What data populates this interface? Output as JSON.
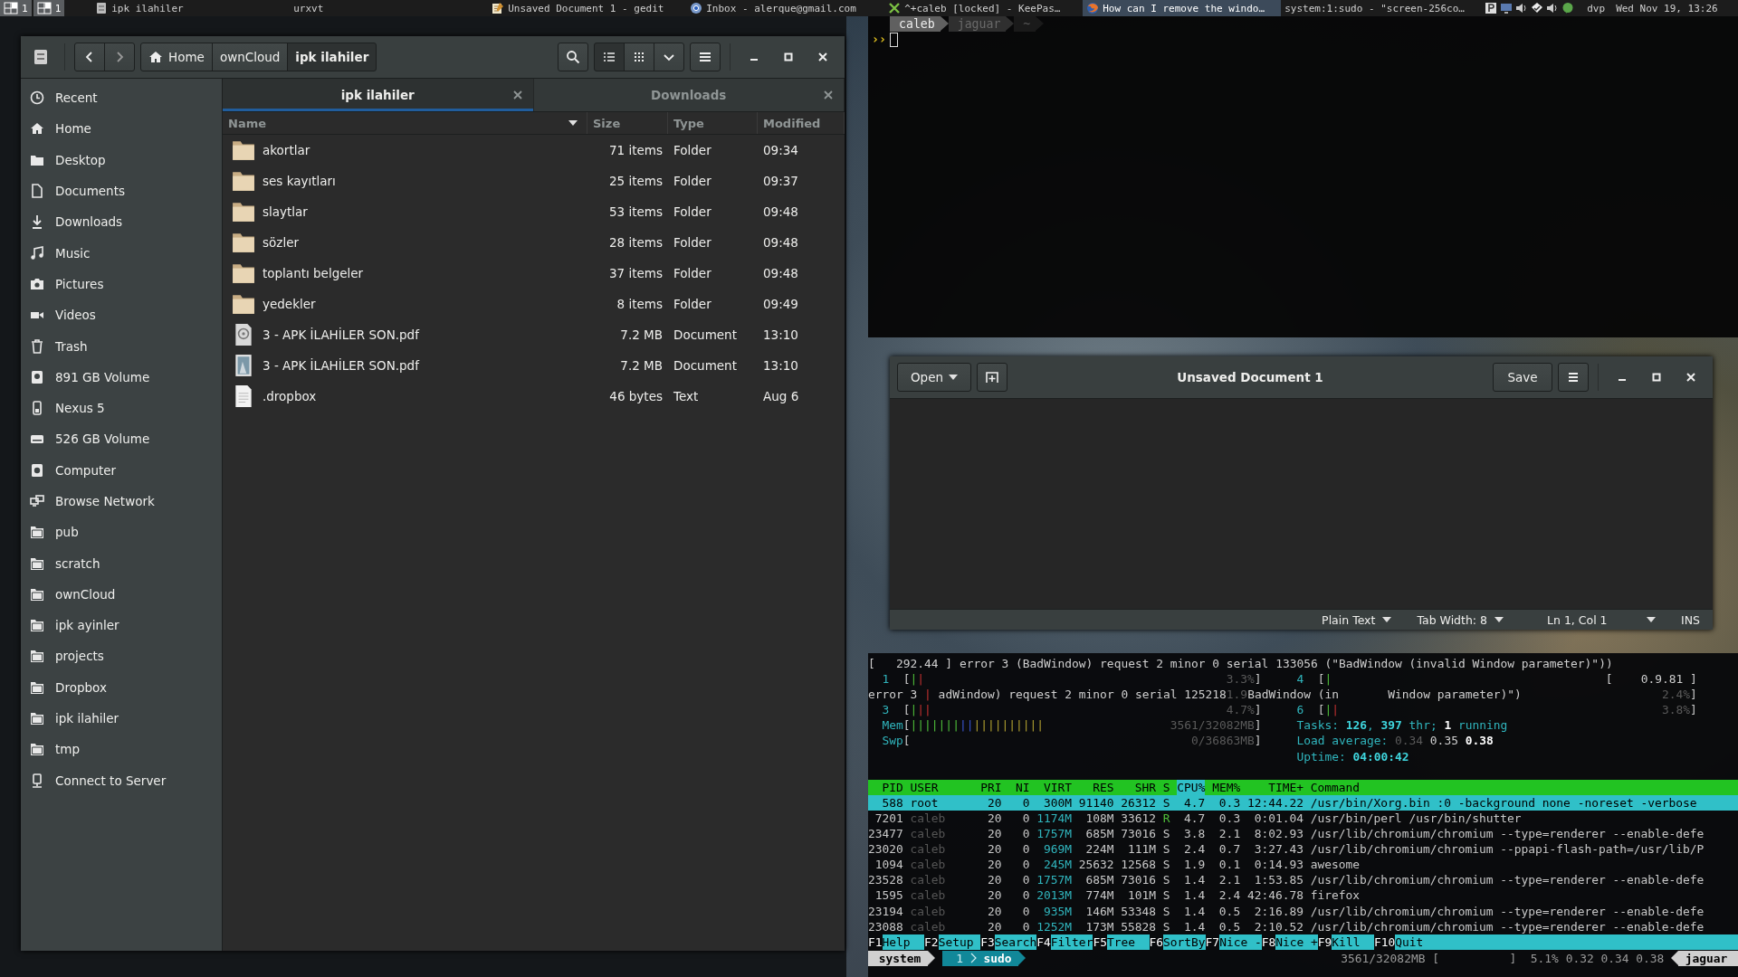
{
  "taskbar": {
    "workspaces": [
      {
        "label": "1"
      },
      {
        "label": "1"
      }
    ],
    "tasks": [
      {
        "title": "ipk ilahiler",
        "kind": "files",
        "selected": false
      },
      {
        "title": "urxvt",
        "kind": "plain",
        "selected": false
      },
      {
        "title": "Unsaved Document 1 - gedit",
        "kind": "editor",
        "selected": false
      },
      {
        "title": "Inbox - alerque@gmail.com",
        "kind": "chrome",
        "selected": false
      },
      {
        "title": "^+caleb [locked] - KeePas…",
        "kind": "keepass",
        "selected": false
      },
      {
        "title": "How can I remove the windo…",
        "kind": "firefox",
        "selected": true
      },
      {
        "title": "system:1:sudo - \"screen-256co…",
        "kind": "plain",
        "selected": false
      }
    ],
    "user": "dvp",
    "clock": "Wed Nov 19, 13:26"
  },
  "terminal": {
    "prompt": [
      {
        "text": "caleb"
      },
      {
        "text": "jaguar"
      },
      {
        "text": "~"
      }
    ],
    "input_prompt": "››"
  },
  "file_manager": {
    "breadcrumbs": [
      {
        "label": "Home",
        "selected": false
      },
      {
        "label": "ownCloud",
        "selected": false
      },
      {
        "label": "ipk ilahiler",
        "selected": true
      }
    ],
    "sidebar": [
      {
        "label": "Recent",
        "kind": "recent"
      },
      {
        "label": "Home",
        "kind": "home"
      },
      {
        "label": "Desktop",
        "kind": "desktop"
      },
      {
        "label": "Documents",
        "kind": "documents"
      },
      {
        "label": "Downloads",
        "kind": "downloads"
      },
      {
        "label": "Music",
        "kind": "music"
      },
      {
        "label": "Pictures",
        "kind": "pictures"
      },
      {
        "label": "Videos",
        "kind": "videos"
      },
      {
        "label": "Trash",
        "kind": "trash"
      },
      {
        "label": "891 GB Volume",
        "kind": "volume"
      },
      {
        "label": "Nexus 5",
        "kind": "phone"
      },
      {
        "label": "526 GB Volume",
        "kind": "drive"
      },
      {
        "label": "Computer",
        "kind": "computer"
      },
      {
        "label": "Browse Network",
        "kind": "network"
      },
      {
        "label": "pub",
        "kind": "folder"
      },
      {
        "label": "scratch",
        "kind": "folder"
      },
      {
        "label": "ownCloud",
        "kind": "folder"
      },
      {
        "label": "ipk ayinler",
        "kind": "folder"
      },
      {
        "label": "projects",
        "kind": "folder"
      },
      {
        "label": "Dropbox",
        "kind": "folder"
      },
      {
        "label": "ipk ilahiler",
        "kind": "folder"
      },
      {
        "label": "tmp",
        "kind": "folder"
      },
      {
        "label": "Connect to Server",
        "kind": "server"
      }
    ],
    "tabs": [
      {
        "label": "ipk ilahiler",
        "selected": true
      },
      {
        "label": "Downloads",
        "selected": false
      }
    ],
    "columns": [
      {
        "label": "Name",
        "sorted": true
      },
      {
        "label": "Size",
        "sorted": false
      },
      {
        "label": "Type",
        "sorted": false
      },
      {
        "label": "Modified",
        "sorted": false
      }
    ],
    "files": [
      {
        "name": "akortlar",
        "size": "71 items",
        "type": "Folder",
        "modified": "09:34",
        "kind": "folder"
      },
      {
        "name": "ses kayıtları",
        "size": "25 items",
        "type": "Folder",
        "modified": "09:37",
        "kind": "folder"
      },
      {
        "name": "slaytlar",
        "size": "53 items",
        "type": "Folder",
        "modified": "09:48",
        "kind": "folder"
      },
      {
        "name": "sözler",
        "size": "28 items",
        "type": "Folder",
        "modified": "09:48",
        "kind": "folder"
      },
      {
        "name": "toplantı belgeler",
        "size": "37 items",
        "type": "Folder",
        "modified": "09:48",
        "kind": "folder"
      },
      {
        "name": "yedekler",
        "size": "8 items",
        "type": "Folder",
        "modified": "09:49",
        "kind": "folder"
      },
      {
        "name": "3 - APK İLAHİLER SON.pdf",
        "size": "7.2 MB",
        "type": "Document",
        "modified": "13:10",
        "kind": "document"
      },
      {
        "name": "3 - APK İLAHİLER SON.pdf",
        "size": "7.2 MB",
        "type": "Document",
        "modified": "13:10",
        "kind": "document-image"
      },
      {
        "name": ".dropbox",
        "size": "46 bytes",
        "type": "Text",
        "modified": "Aug 6",
        "kind": "text"
      }
    ]
  },
  "editor": {
    "open": "Open",
    "title": "Unsaved Document 1",
    "save": "Save",
    "status": [
      {
        "label": "Plain Text",
        "dropdown": true
      },
      {
        "label": "Tab Width: 8",
        "dropdown": true
      },
      {
        "label": "Ln 1, Col 1",
        "dropdown": true
      },
      {
        "label": "INS",
        "dropdown": false
      }
    ]
  },
  "htop": {
    "top": [
      {
        "kind": "message",
        "segments": [
          {
            "text": "[   292.44 ] error 3 (BadWindow) request 2 minor 0 serial 133056 (\"BadWindow (invalid Window parameter)\"))",
            "kind": "text"
          }
        ]
      },
      {
        "kind": "meters",
        "left": {
          "label": "1",
          "open": "[",
          "bars": [
            {
              "text": "|",
              "kind": "green"
            },
            {
              "text": "|",
              "kind": "red"
            }
          ],
          "reading": {
            "text": "3.3%",
            "kind": "dim"
          },
          "close": "]"
        },
        "right": {
          "label": "4",
          "open": "[",
          "bars": [
            {
              "text": "|",
              "kind": "green"
            }
          ],
          "reading": {
            "text": "[    0.9.81 ]",
            "kind": "text"
          }
        }
      },
      {
        "kind": "message",
        "segments": [
          {
            "text": "error 3 ",
            "kind": "text"
          },
          {
            "text": "|",
            "kind": "red"
          },
          {
            "text": " adWindow) request 2 minor 0 serial 125218",
            "kind": "text"
          },
          {
            "text": "1.9",
            "kind": "dim"
          },
          {
            "text": "BadWindow (in       Window parameter)\")",
            "kind": "text"
          }
        ],
        "reading": {
          "text": "2.4%",
          "kind": "dim"
        },
        "close": "]"
      },
      {
        "kind": "meters",
        "left": {
          "label": "3",
          "open": "[",
          "bars": [
            {
              "text": "|",
              "kind": "green"
            },
            {
              "text": "||",
              "kind": "red"
            }
          ],
          "reading": {
            "text": "4.7%",
            "kind": "dim"
          },
          "close": "]"
        },
        "right": {
          "label": "6",
          "open": "[",
          "bars": [
            {
              "text": "|",
              "kind": "green"
            },
            {
              "text": "|",
              "kind": "red"
            }
          ],
          "reading": {
            "text": "3.8%",
            "kind": "dim"
          },
          "close": "]"
        }
      },
      {
        "kind": "meters",
        "left": {
          "label": "Mem",
          "open": "[",
          "bars": [
            {
              "text": "|||||||",
              "kind": "green"
            },
            {
              "text": "||",
              "kind": "blue"
            },
            {
              "text": "||||||||||",
              "kind": "yellow"
            }
          ],
          "reading": {
            "text": "3561/32082MB",
            "kind": "dim"
          },
          "close": "]"
        },
        "info": [
          {
            "text": "Tasks: ",
            "kind": "cyan"
          },
          {
            "text": "126",
            "kind": "cyanbold"
          },
          {
            "text": ", ",
            "kind": "cyan"
          },
          {
            "text": "397",
            "kind": "cyanbold"
          },
          {
            "text": " thr; ",
            "kind": "cyan"
          },
          {
            "text": "1",
            "kind": "bold"
          },
          {
            "text": " running",
            "kind": "cyan"
          }
        ]
      },
      {
        "kind": "meters",
        "left": {
          "label": "Swp",
          "open": "[",
          "reading": {
            "text": "0/36863MB",
            "kind": "dim"
          },
          "close": "]"
        },
        "info": [
          {
            "text": "Load average: ",
            "kind": "cyan"
          },
          {
            "text": "0.34",
            "kind": "dim"
          },
          {
            "text": " 0.35 ",
            "kind": "text"
          },
          {
            "text": "0.38",
            "kind": "bold"
          }
        ]
      },
      {
        "kind": "meters",
        "info": [
          {
            "text": "Uptime: ",
            "kind": "cyan"
          },
          {
            "text": "04:00:42",
            "kind": "cyanbold"
          }
        ]
      }
    ],
    "columns": [
      {
        "label": "PID",
        "sorted": false
      },
      {
        "label": "USER",
        "sorted": false
      },
      {
        "label": "PRI",
        "sorted": false
      },
      {
        "label": "NI",
        "sorted": false
      },
      {
        "label": "VIRT",
        "sorted": false
      },
      {
        "label": "RES",
        "sorted": false
      },
      {
        "label": "SHR",
        "sorted": false
      },
      {
        "label": "S",
        "sorted": false
      },
      {
        "label": "CPU%",
        "sorted": true
      },
      {
        "label": "MEM%",
        "sorted": false
      },
      {
        "label": "TIME+",
        "sorted": false
      },
      {
        "label": "Command",
        "sorted": false
      }
    ],
    "processes": [
      {
        "pid": "588",
        "user": "root",
        "pri": "20",
        "ni": "0",
        "virt": "300M",
        "res": "91140",
        "shr": "26312",
        "state": "S",
        "cpu": "4.7",
        "mem": "0.3",
        "time": "12:44.22",
        "command": "/usr/bin/Xorg.bin :0 -background none -noreset -verbose",
        "selected": true,
        "running": false
      },
      {
        "pid": "7201",
        "user": "caleb",
        "pri": "20",
        "ni": "0",
        "virt": "1174M",
        "res": "108M",
        "shr": "33612",
        "state": "R",
        "cpu": "4.7",
        "mem": "0.3",
        "time": "0:01.04",
        "command": "/usr/bin/perl /usr/bin/shutter",
        "selected": false,
        "running": true
      },
      {
        "pid": "23477",
        "user": "caleb",
        "pri": "20",
        "ni": "0",
        "virt": "1757M",
        "res": "685M",
        "shr": "73016",
        "state": "S",
        "cpu": "3.8",
        "mem": "2.1",
        "time": "8:02.93",
        "command": "/usr/lib/chromium/chromium --type=renderer --enable-defe",
        "selected": false,
        "running": false
      },
      {
        "pid": "23020",
        "user": "caleb",
        "pri": "20",
        "ni": "0",
        "virt": "969M",
        "res": "224M",
        "shr": "111M",
        "state": "S",
        "cpu": "2.4",
        "mem": "0.7",
        "time": "3:27.43",
        "command": "/usr/lib/chromium/chromium --ppapi-flash-path=/usr/lib/P",
        "selected": false,
        "running": false
      },
      {
        "pid": "1094",
        "user": "caleb",
        "pri": "20",
        "ni": "0",
        "virt": "245M",
        "res": "25632",
        "shr": "12568",
        "state": "S",
        "cpu": "1.9",
        "mem": "0.1",
        "time": "0:14.93",
        "command": "awesome",
        "selected": false,
        "running": false
      },
      {
        "pid": "23528",
        "user": "caleb",
        "pri": "20",
        "ni": "0",
        "virt": "1757M",
        "res": "685M",
        "shr": "73016",
        "state": "S",
        "cpu": "1.4",
        "mem": "2.1",
        "time": "1:53.85",
        "command": "/usr/lib/chromium/chromium --type=renderer --enable-defe",
        "selected": false,
        "running": false
      },
      {
        "pid": "1595",
        "user": "caleb",
        "pri": "20",
        "ni": "0",
        "virt": "2013M",
        "res": "774M",
        "shr": "101M",
        "state": "S",
        "cpu": "1.4",
        "mem": "2.4",
        "time": "42:46.78",
        "command": "firefox",
        "selected": false,
        "running": false
      },
      {
        "pid": "23194",
        "user": "caleb",
        "pri": "20",
        "ni": "0",
        "virt": "935M",
        "res": "146M",
        "shr": "53348",
        "state": "S",
        "cpu": "1.4",
        "mem": "0.5",
        "time": "2:16.89",
        "command": "/usr/lib/chromium/chromium --type=renderer --enable-defe",
        "selected": false,
        "running": false
      },
      {
        "pid": "23088",
        "user": "caleb",
        "pri": "20",
        "ni": "0",
        "virt": "1252M",
        "res": "173M",
        "shr": "55828",
        "state": "S",
        "cpu": "1.4",
        "mem": "0.5",
        "time": "2:10.52",
        "command": "/usr/lib/chromium/chromium --type=renderer --enable-defe",
        "selected": false,
        "running": false
      }
    ],
    "function_keys": [
      {
        "key": "F1",
        "label": "Help"
      },
      {
        "key": "F2",
        "label": "Setup"
      },
      {
        "key": "F3",
        "label": "Search"
      },
      {
        "key": "F4",
        "label": "Filter"
      },
      {
        "key": "F5",
        "label": "Tree"
      },
      {
        "key": "F6",
        "label": "SortBy"
      },
      {
        "key": "F7",
        "label": "Nice -"
      },
      {
        "key": "F8",
        "label": "Nice +"
      },
      {
        "key": "F9",
        "label": "Kill"
      },
      {
        "key": "F10",
        "label": "Quit"
      }
    ],
    "screen_bar": {
      "session": "system",
      "window_number": "1",
      "window_name": "sudo",
      "status": "3561/32082MB [          ]  5.1% 0.32 0.34 0.38",
      "host": "jaguar"
    }
  }
}
